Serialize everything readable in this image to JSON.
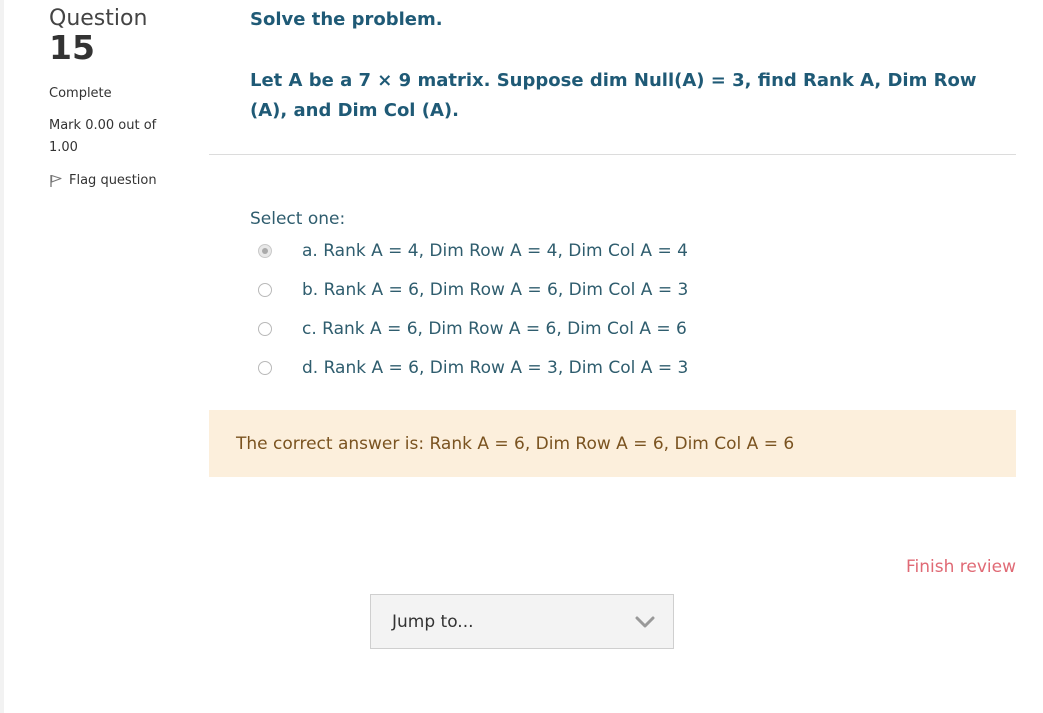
{
  "question_info": {
    "label": "Question",
    "number": "15",
    "state": "Complete",
    "grade": "Mark 0.00 out of 1.00",
    "flag_label": "Flag question"
  },
  "question": {
    "intro": "Solve the problem.",
    "text": "Let A be a 7 × 9 matrix. Suppose dim Null(A) = 3, find Rank A, Dim Row (A), and Dim Col (A)."
  },
  "answer": {
    "prompt": "Select one:",
    "options": [
      {
        "label": "a. Rank A = 4, Dim Row A = 4, Dim Col A = 4",
        "selected": true
      },
      {
        "label": "b. Rank A = 6, Dim Row A = 6, Dim Col A = 3",
        "selected": false
      },
      {
        "label": "c. Rank A = 6, Dim Row A = 6, Dim Col A = 6",
        "selected": false
      },
      {
        "label": "d. Rank A = 6, Dim Row A = 3, Dim Col A = 3",
        "selected": false
      }
    ]
  },
  "feedback": {
    "right_answer": "The correct answer is: Rank A = 6, Dim Row A = 6, Dim Col A = 6"
  },
  "navigation": {
    "finish_review": "Finish review",
    "jump_to": "Jump to..."
  },
  "colors": {
    "question_text": "#1f5a76",
    "feedback_bg": "#fcefdc",
    "feedback_text": "#7a5320",
    "finish_link": "#e06a75"
  },
  "icons": {
    "flag": "flag-icon",
    "dropdown": "chevron-down-icon"
  }
}
